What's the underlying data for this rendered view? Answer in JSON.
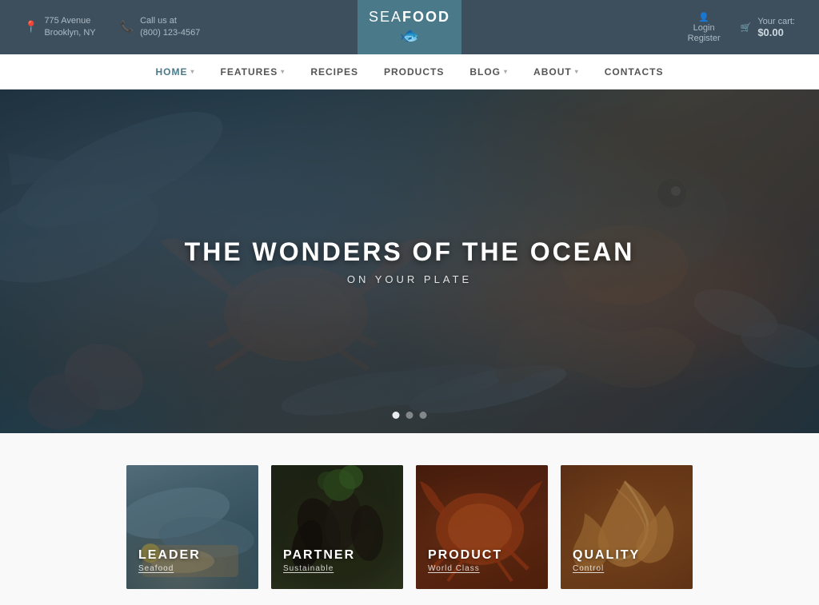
{
  "topbar": {
    "address_icon": "📍",
    "address_line1": "775 Avenue",
    "address_line2": "Brooklyn, NY",
    "phone_icon": "📞",
    "phone_label": "Call us at",
    "phone_number": "(800) 123-4567",
    "logo_sea": "SEA",
    "logo_food": "FOOD",
    "login_label": "Login",
    "register_label": "Register",
    "cart_icon": "🛒",
    "cart_label": "Your cart:",
    "cart_amount": "$0.00"
  },
  "nav": {
    "items": [
      {
        "label": "HOME",
        "has_arrow": true,
        "active": true
      },
      {
        "label": "FEATURES",
        "has_arrow": true,
        "active": false
      },
      {
        "label": "RECIPES",
        "has_arrow": false,
        "active": false
      },
      {
        "label": "PRODUCTS",
        "has_arrow": false,
        "active": false
      },
      {
        "label": "BLOG",
        "has_arrow": true,
        "active": false
      },
      {
        "label": "ABOUT",
        "has_arrow": true,
        "active": false
      },
      {
        "label": "CONTACTS",
        "has_arrow": false,
        "active": false
      }
    ]
  },
  "hero": {
    "title": "THE WONDERS OF THE OCEAN",
    "subtitle": "ON YOUR PLATE",
    "dots": 3,
    "active_dot": 0
  },
  "categories": [
    {
      "title": "LEADER",
      "subtitle": "Seafood",
      "bg_class": "cat-bg-1"
    },
    {
      "title": "PARTNER",
      "subtitle": "Sustainable",
      "bg_class": "cat-bg-2"
    },
    {
      "title": "PRODUCT",
      "subtitle": "World Class",
      "bg_class": "cat-bg-3"
    },
    {
      "title": "QUALITY",
      "subtitle": "Control",
      "bg_class": "cat-bg-4"
    }
  ]
}
